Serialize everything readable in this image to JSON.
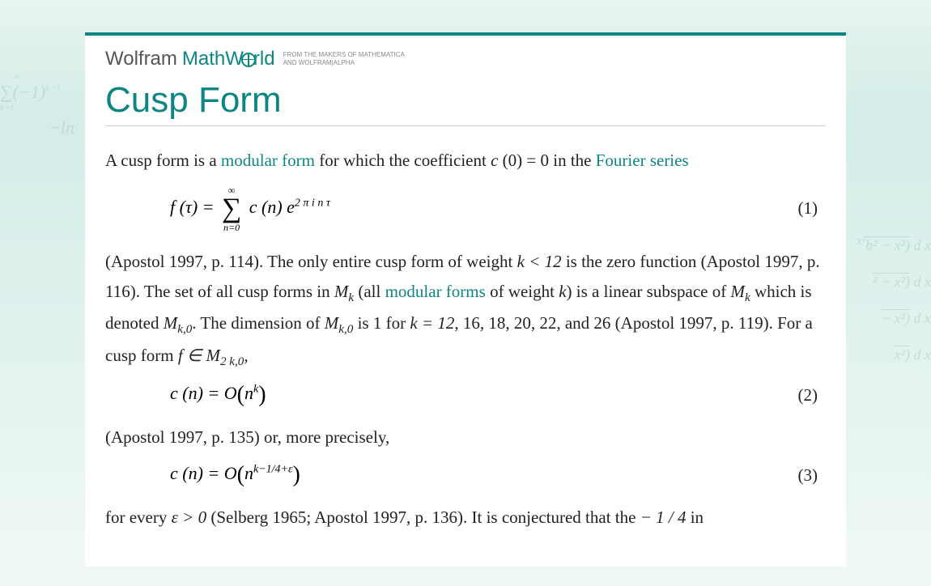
{
  "brand": {
    "wolfram": "Wolfram",
    "mathworld_pre": "MathW",
    "mathworld_post": "rld",
    "tagline_1": "FROM THE MAKERS OF MATHEMATICA",
    "tagline_2": "AND WOLFRAM|ALPHA"
  },
  "title": "Cusp Form",
  "para1": {
    "t1": "A cusp form is a ",
    "link1": "modular form",
    "t2": " for which the coefficient ",
    "math1_var": "c",
    "math1_rest": " (0) = 0",
    "t3": " in the ",
    "link2": "Fourier series"
  },
  "eq1": {
    "lhs": "f (τ) = ",
    "sum_top": "∞",
    "sum_bot": "n=0",
    "rhs1": "c (n) e",
    "exp": "2 π i n τ",
    "num": "(1)"
  },
  "para2": {
    "t1": "(Apostol 1997, p. 114). The only entire cusp form of weight ",
    "m1": "k < 12",
    "t2": " is the zero function (Apostol 1997, p. 116). The set of all cusp forms in ",
    "m2a": "M",
    "m2b": "k",
    "t3": " (all ",
    "link1": "modular forms",
    "t4": " of weight ",
    "m3": "k",
    "t5": ") is a linear subspace of ",
    "m4a": "M",
    "m4b": "k",
    "t6": " which is denoted ",
    "m5a": "M",
    "m5b": "k,0",
    "t7": ". The dimension of ",
    "m6a": "M",
    "m6b": "k,0",
    "t8": " is 1 for ",
    "m7": "k = 12",
    "t9": ", 16, 18, 20, 22, and 26 (Apostol 1997, p. 119). For a cusp form ",
    "m8": "f ∈ M",
    "m8sub": "2 k,0",
    "t10": ","
  },
  "eq2": {
    "full_a": "c (n) = O",
    "full_b": "n",
    "full_c": "k",
    "num": "(2)"
  },
  "para3": {
    "t1": "(Apostol 1997, p. 135) or, more precisely,"
  },
  "eq3": {
    "a": "c (n) = O",
    "b": "n",
    "c": "k−1/4+ε",
    "num": "(3)"
  },
  "para4": {
    "t1": "for every ",
    "m1": "ε > 0",
    "t2": " (Selberg 1965; Apostol 1997, p. 136). It is conjectured that the ",
    "m2": "− 1 / 4",
    "t3": " in"
  },
  "decor": {
    "left_top": "∞",
    "left_sum": "∑(−1)",
    "left_exp": "k−1",
    "left_bot": "k=1",
    "left_ln": "−ln",
    "r1a": "x²",
    "r1b": "b² − x²)",
    "r1c": "d x",
    "r2b": "² − x²)",
    "r2c": "d x",
    "r3b": "− x²)",
    "r3c": "d x",
    "r4b": "x²)",
    "r4c": "d x"
  }
}
